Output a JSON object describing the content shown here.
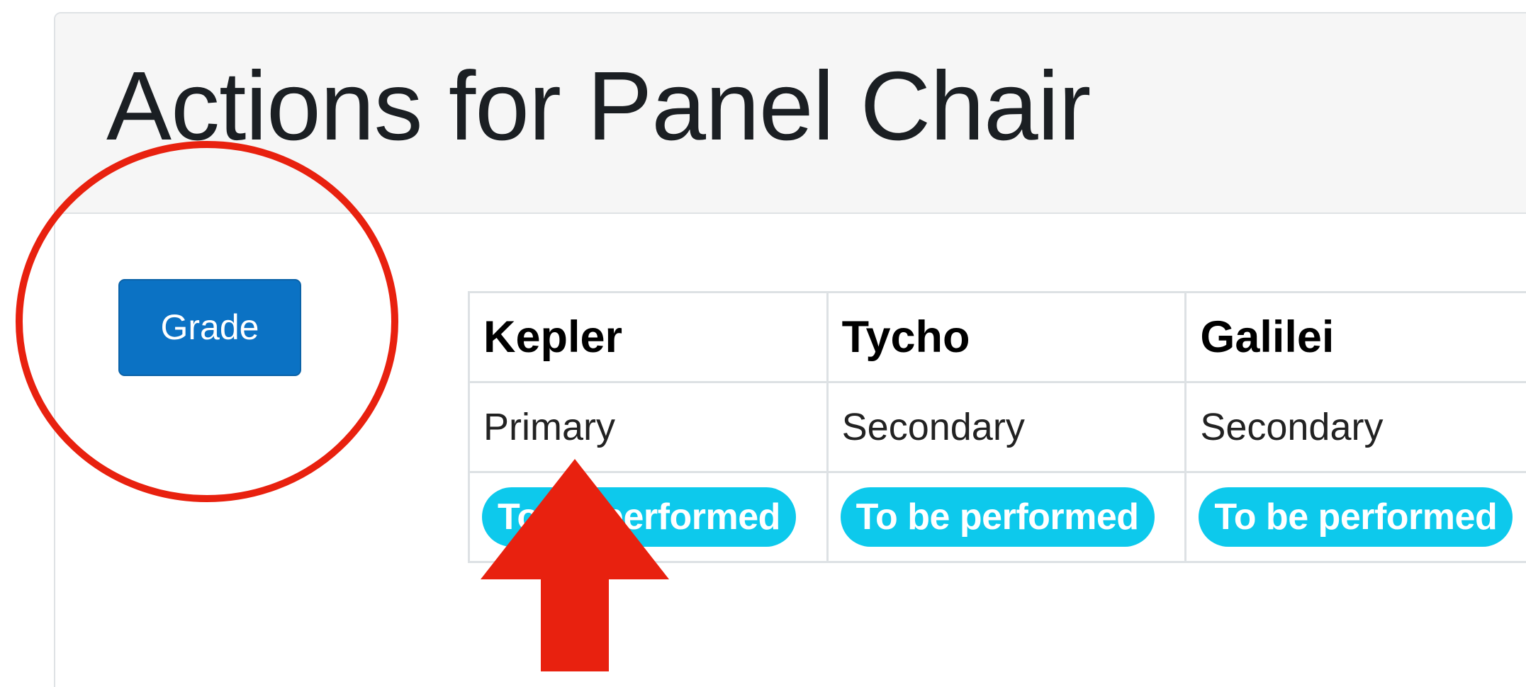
{
  "header": {
    "title": "Actions for Panel Chair"
  },
  "actions": {
    "grade_label": "Grade"
  },
  "panel": {
    "columns": [
      {
        "name": "Kepler",
        "role": "Primary",
        "status": "To be performed"
      },
      {
        "name": "Tycho",
        "role": "Secondary",
        "status": "To be performed"
      },
      {
        "name": "Galilei",
        "role": "Secondary",
        "status": "To be performed"
      }
    ]
  },
  "colors": {
    "primary_button": "#0b72c4",
    "status_badge": "#0dc9ec",
    "annotation": "#e8210f"
  },
  "annotations": {
    "circle_icon": "red-circle-highlight-icon",
    "arrow_icon": "red-up-arrow-icon"
  }
}
